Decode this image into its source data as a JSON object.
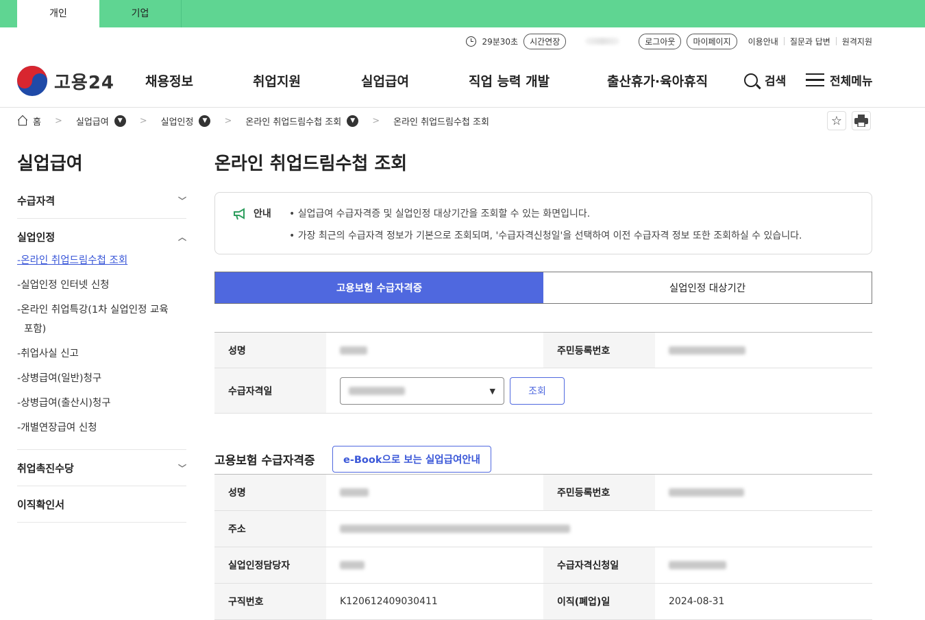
{
  "top_tabs": {
    "personal": "개인",
    "business": "기업"
  },
  "utility": {
    "timer": "29분30초",
    "extend": "시간연장",
    "logout": "로그아웃",
    "mypage": "마이페이지",
    "guide": "이용안내",
    "qna": "질문과 답변",
    "remote": "원격지원"
  },
  "logo": {
    "text": "고용24"
  },
  "gnb": {
    "items": [
      "채용정보",
      "취업지원",
      "실업급여",
      "직업 능력 개발",
      "출산휴가·육아휴직"
    ],
    "search": "검색",
    "menu": "전체메뉴"
  },
  "breadcrumb": {
    "home": "홈",
    "level1": "실업급여",
    "level2": "실업인정",
    "level3": "온라인 취업드림수첩 조회",
    "current": "온라인 취업드림수첩 조회"
  },
  "sidebar": {
    "title": "실업급여",
    "groups": [
      "수급자격",
      "실업인정",
      "취업촉진수당",
      "이직확인서"
    ],
    "sub_items": [
      "-온라인 취업드림수첩 조회",
      "-실업인정 인터넷 신청",
      "-온라인 취업특강(1차 실업인정 교육",
      "포함)",
      "-취업사실 신고",
      "-상병급여(일반)청구",
      "-상병급여(출산시)청구",
      "-개별연장급여 신청"
    ]
  },
  "main": {
    "title": "온라인 취업드림수첩 조회",
    "notice_label": "안내",
    "notice_lines": [
      "• 실업급여 수급자격증 및 실업인정 대상기간을 조회할 수 있는 화면입니다.",
      "• 가장 최근의 수급자격 정보가 기본으로 조회되며, '수급자격신청일'을 선택하여 이전 수급자격 정보 또한 조회하실 수 있습니다."
    ],
    "tabs": [
      "고용보험 수급자격증",
      "실업인정 대상기간"
    ],
    "form": {
      "name_label": "성명",
      "rrn_label": "주민등록번호",
      "date_label": "수급자격일",
      "query_button": "조회"
    },
    "section_title": "고용보험 수급자격증",
    "ebook_button": "e-Book으로 보는 실업급여안내",
    "cert": {
      "name_label": "성명",
      "rrn_label": "주민등록번호",
      "address_label": "주소",
      "officer_label": "실업인정담당자",
      "apply_date_label": "수급자격신청일",
      "job_no_label": "구직번호",
      "job_no_value": "K120612409030411",
      "leave_date_label": "이직(폐업)일",
      "leave_date_value": "2024-08-31"
    }
  },
  "colors": {
    "accent_green": "#5fd592",
    "primary_blue": "#4f68df"
  }
}
